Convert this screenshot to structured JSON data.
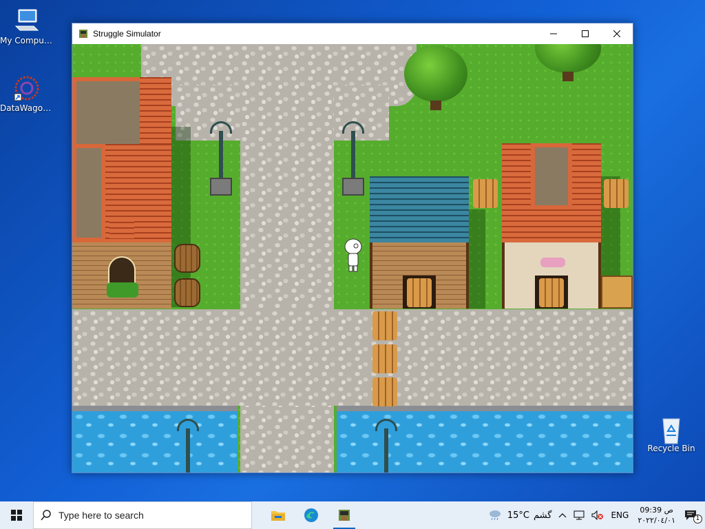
{
  "desktop": {
    "icons": [
      {
        "label": "My Computer",
        "icon": "computer-icon"
      },
      {
        "label": "DataWagon...",
        "icon": "datawagon-icon"
      },
      {
        "label": "Recycle Bin",
        "icon": "recycle-bin-icon"
      }
    ]
  },
  "window": {
    "title": "Struggle Simulator",
    "controls": {
      "minimize": "minimize-icon",
      "maximize": "maximize-icon",
      "close": "close-icon"
    }
  },
  "taskbar": {
    "search_placeholder": "Type here to search",
    "apps": [
      "file-explorer-icon",
      "edge-icon",
      "struggle-simulator-icon"
    ],
    "tray": {
      "weather_temp": "15°C",
      "weather_text": "گشم",
      "language": "ENG",
      "time": "09:39 ص",
      "date": "٢٠٢٢/٠٤/٠١",
      "notification_count": "1"
    }
  },
  "colors": {
    "grass": "#56ad2d",
    "water": "#2f9fdc",
    "roof_red": "#c4532c",
    "roof_blue": "#2b6f86"
  }
}
